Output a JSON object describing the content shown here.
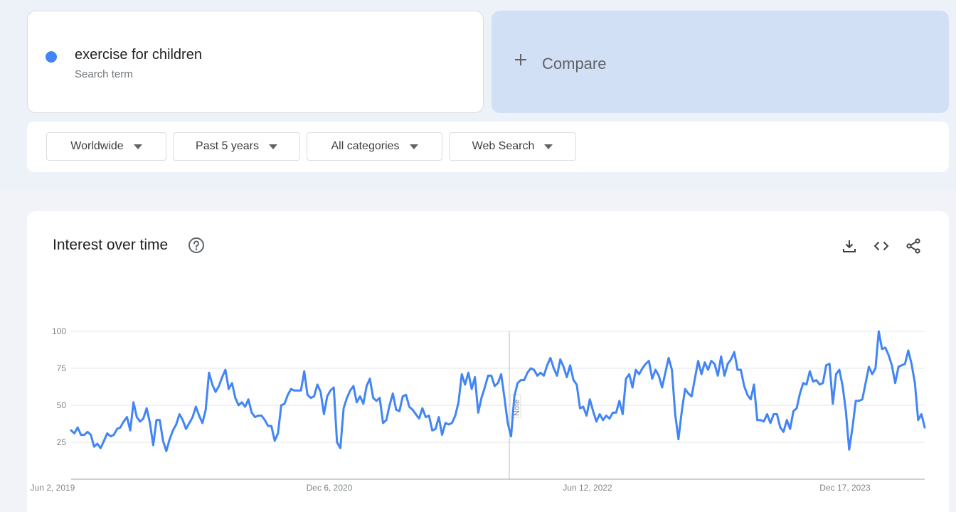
{
  "search_term": {
    "name": "exercise for children",
    "type": "Search term",
    "color": "#4285f4"
  },
  "compare": {
    "label": "Compare"
  },
  "filters": [
    {
      "label": "Worldwide"
    },
    {
      "label": "Past 5 years"
    },
    {
      "label": "All categories"
    },
    {
      "label": "Web Search"
    }
  ],
  "chart_section": {
    "title": "Interest over time",
    "note": "Note",
    "icons": [
      "help-icon",
      "download-icon",
      "embed-icon",
      "share-icon"
    ]
  },
  "chart_data": {
    "type": "line",
    "ylim": [
      0,
      100
    ],
    "yticks": [
      25,
      50,
      75,
      100
    ],
    "xlabels": [
      "Jun 2, 2019",
      "Dec 6, 2020",
      "Jun 12, 2022",
      "Dec 17, 2023"
    ],
    "grid": true,
    "line_color": "#4285f4",
    "series": [
      {
        "values": [
          33,
          31,
          35,
          30,
          30,
          32,
          30,
          22,
          24,
          21,
          26,
          31,
          29,
          30,
          34,
          35,
          39,
          42,
          33,
          52,
          42,
          39,
          41,
          48,
          38,
          23,
          40,
          40,
          26,
          19,
          27,
          33,
          37,
          44,
          40,
          34,
          38,
          42,
          49,
          43,
          38,
          47,
          72,
          64,
          59,
          63,
          69,
          74,
          61,
          65,
          55,
          50,
          52,
          49,
          54,
          45,
          42,
          43,
          43,
          40,
          36,
          36,
          26,
          31,
          50,
          51,
          57,
          61,
          60,
          60,
          60,
          73,
          57,
          55,
          56,
          64,
          59,
          44,
          56,
          60,
          62,
          25,
          21,
          48,
          55,
          60,
          63,
          52,
          56,
          51,
          63,
          68,
          55,
          53,
          55,
          38,
          40,
          50,
          58,
          47,
          46,
          56,
          57,
          49,
          47,
          44,
          41,
          48,
          42,
          43,
          33,
          34,
          42,
          30,
          38,
          37,
          38,
          43,
          52,
          71,
          64,
          72,
          61,
          69,
          45,
          55,
          62,
          70,
          70,
          63,
          65,
          71,
          55,
          38,
          29,
          56,
          65,
          67,
          67,
          72,
          75,
          74,
          70,
          72,
          70,
          77,
          82,
          75,
          70,
          81,
          76,
          69,
          77,
          67,
          64,
          48,
          49,
          43,
          54,
          46,
          39,
          44,
          40,
          43,
          41,
          45,
          45,
          53,
          44,
          68,
          71,
          62,
          74,
          71,
          75,
          78,
          80,
          68,
          74,
          70,
          62,
          72,
          82,
          74,
          44,
          27,
          46,
          61,
          58,
          56,
          68,
          80,
          71,
          79,
          74,
          80,
          78,
          70,
          83,
          70,
          78,
          81,
          86,
          74,
          74,
          63,
          57,
          54,
          64,
          40,
          40,
          39,
          44,
          38,
          44,
          44,
          35,
          32,
          40,
          34,
          46,
          48,
          58,
          65,
          64,
          73,
          66,
          67,
          64,
          65,
          77,
          78,
          51,
          71,
          74,
          63,
          46,
          20,
          35,
          53,
          53,
          54,
          65,
          76,
          71,
          75,
          100,
          88,
          89,
          84,
          77,
          65,
          76,
          77,
          78,
          87,
          78,
          65,
          40,
          44,
          35
        ]
      }
    ]
  }
}
